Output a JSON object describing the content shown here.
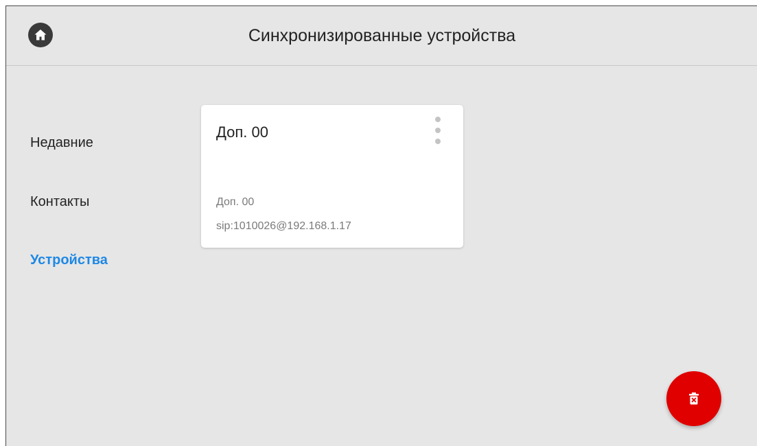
{
  "header": {
    "title": "Синхронизированные устройства",
    "home_icon": "home-icon"
  },
  "nav": {
    "items": [
      {
        "label": "Недавние",
        "active": false
      },
      {
        "label": "Контакты",
        "active": false
      },
      {
        "label": "Устройства",
        "active": true
      }
    ]
  },
  "device_card": {
    "title": "Доп. 00",
    "name": "Доп. 00",
    "address": "sip:1010026@192.168.1.17",
    "menu_icon": "more-vertical-icon"
  },
  "fab": {
    "icon": "delete-icon"
  },
  "colors": {
    "background": "#e6e6e6",
    "accent": "#1e88e5",
    "danger": "#e00000",
    "card": "#ffffff",
    "home_button": "#3a3a3a"
  }
}
